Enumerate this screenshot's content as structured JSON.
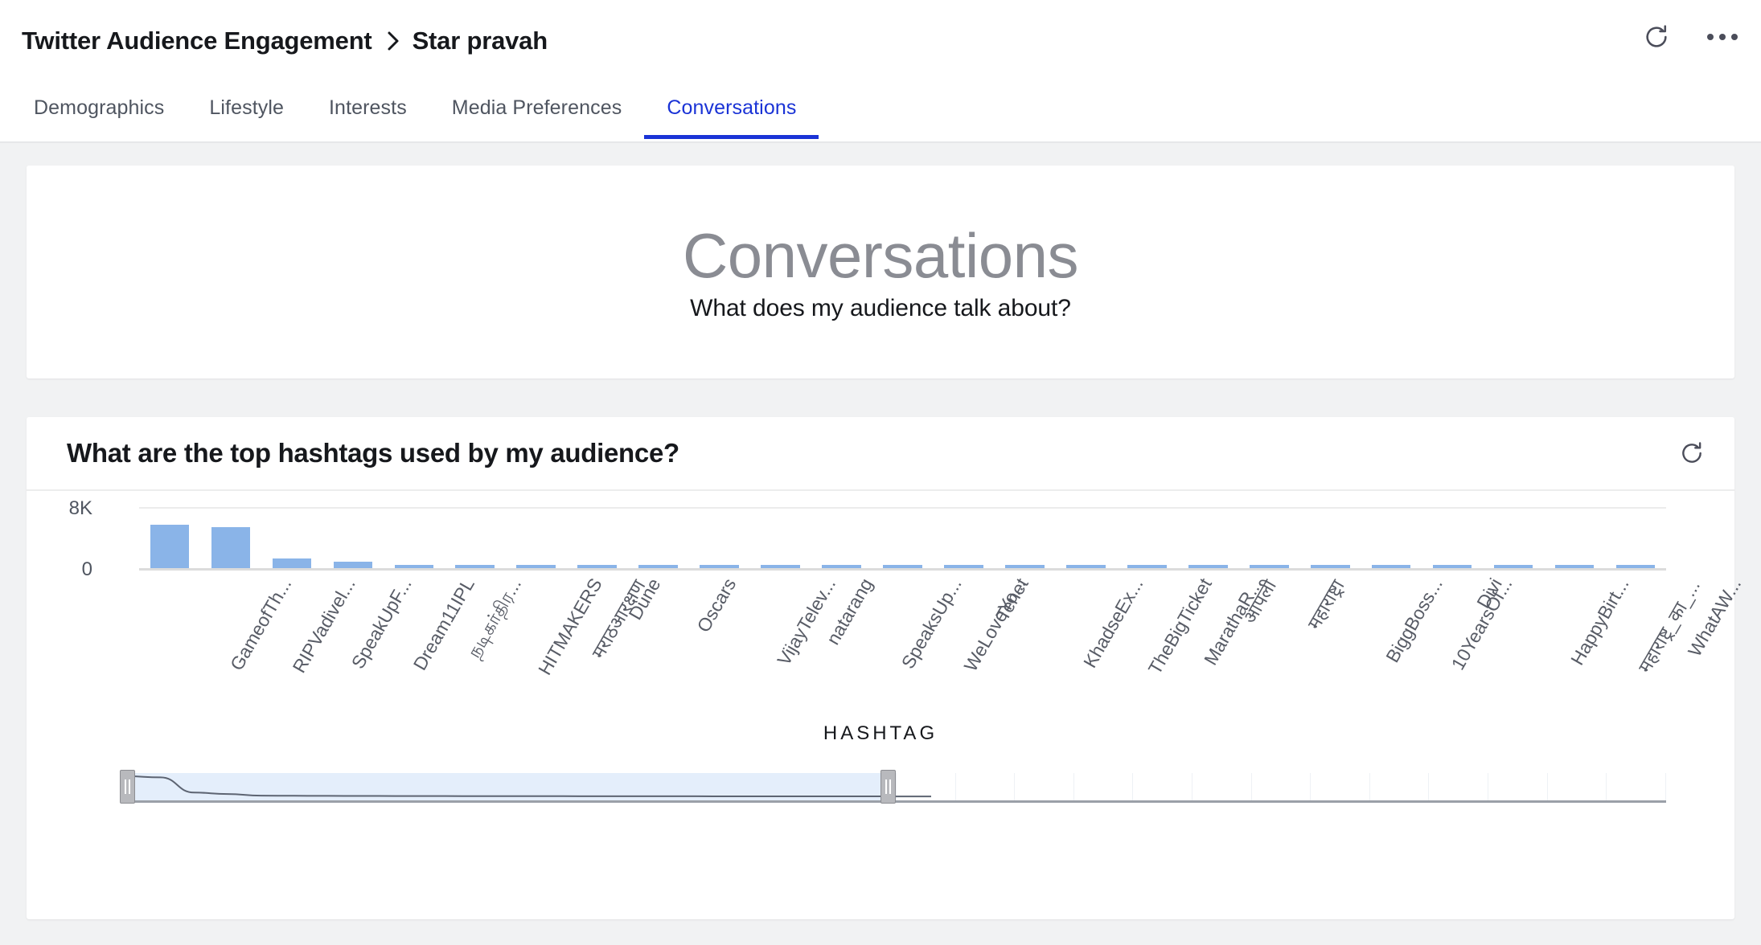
{
  "header": {
    "breadcrumb_root": "Twitter Audience Engagement",
    "breadcrumb_separator": "›",
    "breadcrumb_current": "Star pravah",
    "refresh_icon": "refresh-icon",
    "more_icon": "more-options-icon"
  },
  "tabs": [
    {
      "label": "Demographics",
      "active": false
    },
    {
      "label": "Lifestyle",
      "active": false
    },
    {
      "label": "Interests",
      "active": false
    },
    {
      "label": "Media Preferences",
      "active": false
    },
    {
      "label": "Conversations",
      "active": true
    }
  ],
  "hero": {
    "title": "Conversations",
    "subtitle": "What does my audience talk about?"
  },
  "chart_card": {
    "title": "What are the top hashtags used by my audience?",
    "refresh_icon": "refresh-icon"
  },
  "colors": {
    "bar": "#8ab4e8",
    "active_tab": "#1a33d6",
    "hero_title": "#8a8c93",
    "page_bg": "#f1f2f3",
    "brush_selection": "#e4eefb"
  },
  "chart_data": {
    "type": "bar",
    "title": "What are the top hashtags used by my audience?",
    "xlabel": "HASHTAG",
    "ylabel": "",
    "ylim": [
      0,
      8000
    ],
    "ytick_labels": [
      "8K",
      "0"
    ],
    "ytick_values": [
      8000,
      0
    ],
    "grid": true,
    "legend": null,
    "categories": [
      "GameofTh...",
      "RIPVadivel...",
      "SpeakUpF...",
      "Dream11IPL",
      "நடிகர்திர...",
      "HITMAKERS",
      "मराठआरक्षण",
      "Dune",
      "Oscars",
      "VijayTelev...",
      "natarang",
      "SpeaksUp...",
      "WeLoveYo...",
      "Tenet",
      "KhadseEx...",
      "TheBigTicket",
      "MarathaR...",
      "आपली",
      "महाराष्ट्रा",
      "BiggBoss...",
      "10YearsOf...",
      "Divi",
      "HappyBirt...",
      "महाराष्ट्र_का_...",
      "WhatAW..."
    ],
    "values": [
      5700,
      5400,
      1250,
      850,
      420,
      380,
      350,
      330,
      310,
      300,
      290,
      280,
      270,
      260,
      250,
      245,
      240,
      235,
      230,
      225,
      220,
      215,
      210,
      205,
      200
    ]
  },
  "range_selector": {
    "name": "chart-range-selector",
    "selection_start_pct": 0,
    "selection_end_pct": 49.5,
    "left_handle": "range-handle-left",
    "right_handle": "range-handle-right"
  }
}
